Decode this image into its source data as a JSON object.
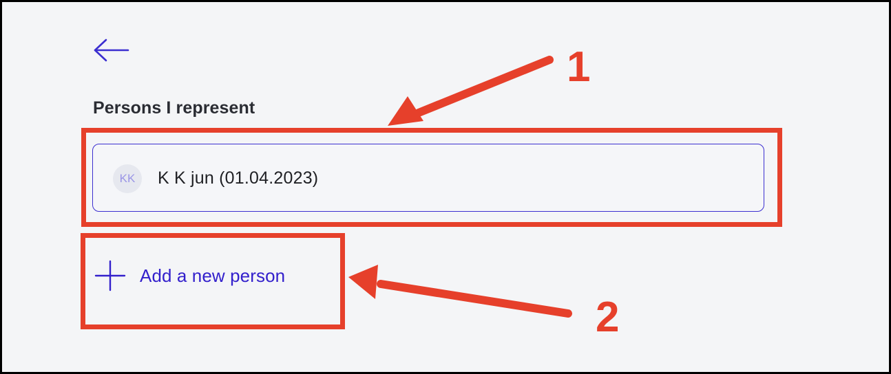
{
  "page": {
    "back_icon": "arrow-left-icon",
    "section_title": "Persons I represent"
  },
  "persons": [
    {
      "initials": "KK",
      "name": "K K jun (01.04.2023)"
    }
  ],
  "add_person": {
    "icon": "plus-icon",
    "label": "Add a new person"
  },
  "annotations": {
    "step_1": "1",
    "step_2": "2"
  },
  "colors": {
    "accent": "#3b2ed0",
    "link": "#3320cc",
    "annotation": "#e6402b",
    "background": "#f4f5f7",
    "text": "#1f2024"
  }
}
